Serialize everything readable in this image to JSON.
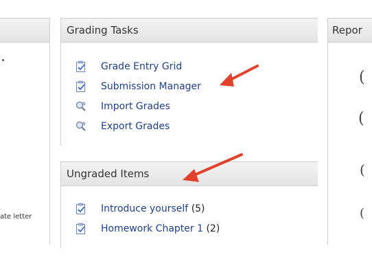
{
  "left_panel": {
    "text_fragment": "ate letter"
  },
  "grading_tasks": {
    "title": "Grading Tasks",
    "items": [
      {
        "label": "Grade Entry Grid",
        "icon": "clipboard-check-icon"
      },
      {
        "label": "Submission Manager",
        "icon": "clipboard-check-icon"
      },
      {
        "label": "Import Grades",
        "icon": "magnifier-gear-icon"
      },
      {
        "label": "Export Grades",
        "icon": "magnifier-gear-icon"
      }
    ]
  },
  "ungraded_items": {
    "title": "Ungraded Items",
    "items": [
      {
        "label": "Introduce yourself",
        "count": "(5)",
        "icon": "clipboard-check-icon"
      },
      {
        "label": "Homework Chapter 1",
        "count": "(2)",
        "icon": "clipboard-check-icon"
      }
    ]
  },
  "report_panel": {
    "title": "Repor"
  },
  "annotation_color": "#e2422b"
}
